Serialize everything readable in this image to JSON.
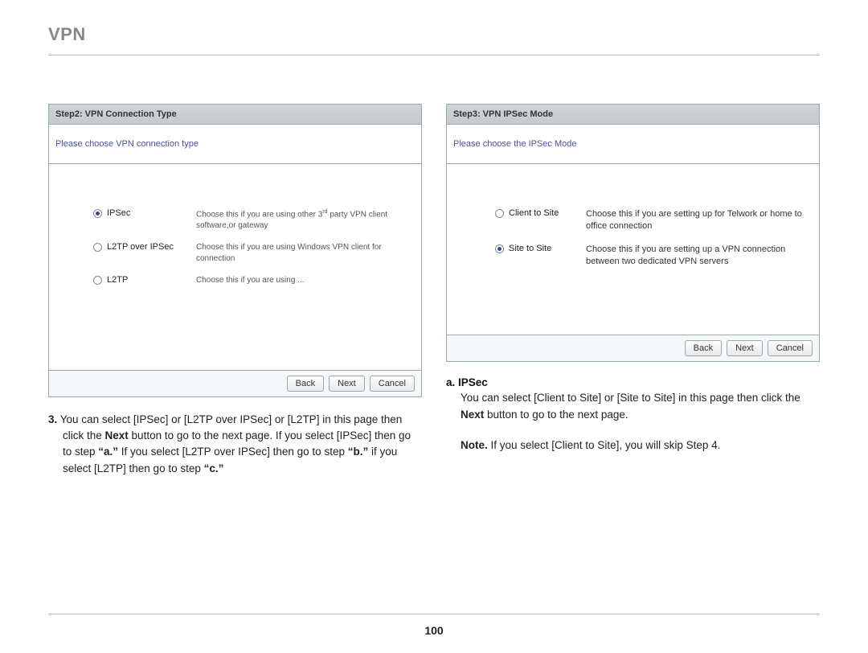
{
  "page_title": "VPN",
  "page_number": "100",
  "left": {
    "header": "Step2: VPN Connection Type",
    "banner": "Please choose VPN connection type",
    "options": [
      {
        "label": "IPSec",
        "desc_pre": "Choose this if you are using other 3",
        "desc_sup": "rd",
        "desc_post": " party VPN client software,or gateway",
        "selected": true
      },
      {
        "label": "L2TP over IPSec",
        "desc": "Choose this if you are using Windows VPN client for connection",
        "selected": false
      },
      {
        "label": "L2TP",
        "desc": "Choose this if you are using ...",
        "selected": false
      }
    ],
    "buttons": {
      "back": "Back",
      "next": "Next",
      "cancel": "Cancel"
    },
    "caption_num": "3.",
    "caption_a": " You can select [IPSec] or [L2TP over IPSec] or [L2TP] in this page then click the ",
    "caption_next": "Next",
    "caption_b": " button to go to the next page. If you select [IPSec] then go to step ",
    "caption_qa": "“a.”",
    "caption_c": " If you select [L2TP over IPSec] then go to step ",
    "caption_qb": "“b.”",
    "caption_d": " if you select [L2TP] then go to step ",
    "caption_qc": "“c.”"
  },
  "right": {
    "header": "Step3: VPN IPSec Mode",
    "banner": "Please choose the IPSec Mode",
    "options": [
      {
        "label": "Client to Site",
        "desc": "Choose this if you are setting up for Telwork or home to office connection",
        "selected": false
      },
      {
        "label": "Site to Site",
        "desc": "Choose this if you are setting up a VPN connection between two dedicated VPN servers",
        "selected": true
      }
    ],
    "buttons": {
      "back": "Back",
      "next": "Next",
      "cancel": "Cancel"
    },
    "caption_sub": "a. IPSec",
    "caption_a": "You can select [Client to Site] or [Site to Site] in this page then click the ",
    "caption_next": "Next",
    "caption_b": " button to go to the next page.",
    "note_label": "Note.",
    "note_body": " If you select [Client to Site], you will skip Step 4."
  }
}
